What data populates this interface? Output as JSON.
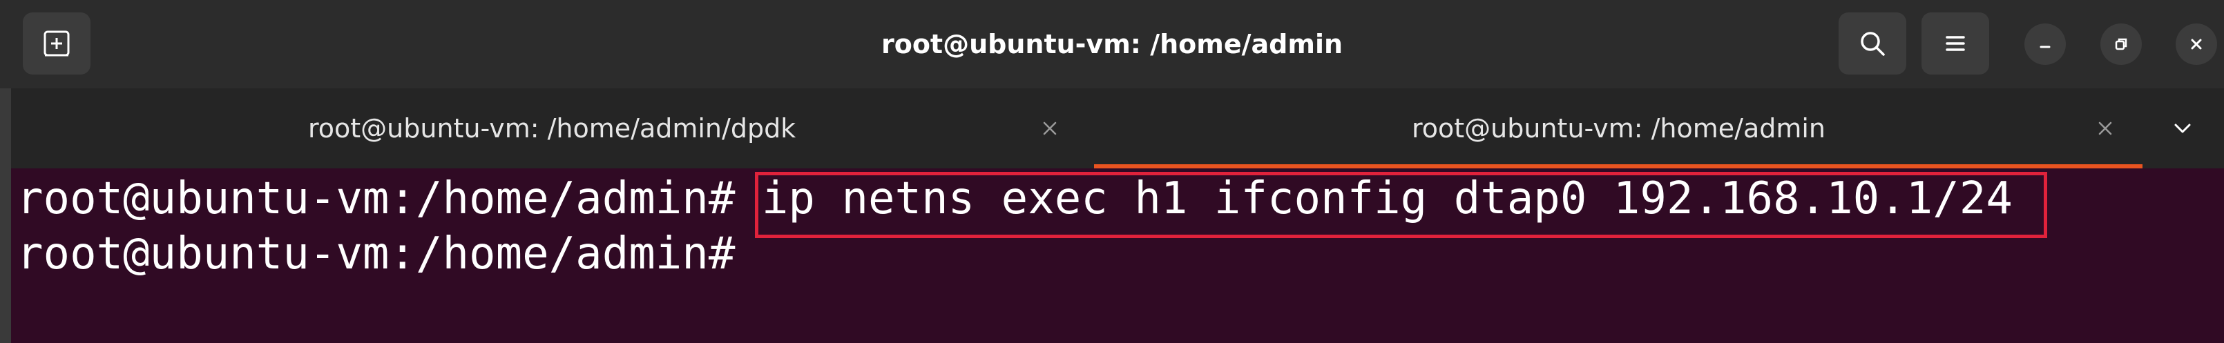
{
  "window": {
    "title": "root@ubuntu-vm: /home/admin"
  },
  "header": {
    "new_tab_icon": "new-tab-icon",
    "search_icon": "search-icon",
    "menu_icon": "hamburger-menu-icon",
    "minimize_icon": "minimize-icon",
    "maximize_icon": "restore-icon",
    "close_icon": "close-icon"
  },
  "tabs": [
    {
      "label": "root@ubuntu-vm: /home/admin/dpdk",
      "active": false
    },
    {
      "label": "root@ubuntu-vm: /home/admin",
      "active": true
    }
  ],
  "terminal": {
    "lines": [
      {
        "prompt": "root@ubuntu-vm:/home/admin#",
        "command": "ip netns exec h1 ifconfig dtap0 192.168.10.1/24"
      },
      {
        "prompt": "root@ubuntu-vm:/home/admin#",
        "command": ""
      }
    ],
    "highlight_color": "#e0223b",
    "background_color": "#300a24"
  },
  "colors": {
    "accent": "#e95420",
    "headerbar": "#2c2c2c",
    "tabbar": "#252525"
  }
}
